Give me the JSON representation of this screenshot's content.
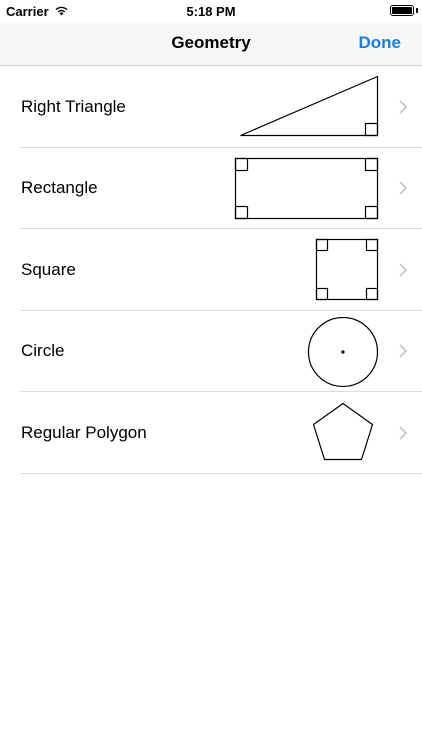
{
  "status_bar": {
    "carrier": "Carrier",
    "time": "5:18 PM",
    "wifi_icon": "wifi-icon",
    "battery_level": 1.0
  },
  "nav": {
    "title": "Geometry",
    "done_label": "Done",
    "accent_color": "#147efb"
  },
  "shapes": [
    {
      "label": "Right Triangle",
      "icon": "right-triangle-icon"
    },
    {
      "label": "Rectangle",
      "icon": "rectangle-icon"
    },
    {
      "label": "Square",
      "icon": "square-icon"
    },
    {
      "label": "Circle",
      "icon": "circle-icon"
    },
    {
      "label": "Regular Polygon",
      "icon": "pentagon-icon"
    }
  ]
}
